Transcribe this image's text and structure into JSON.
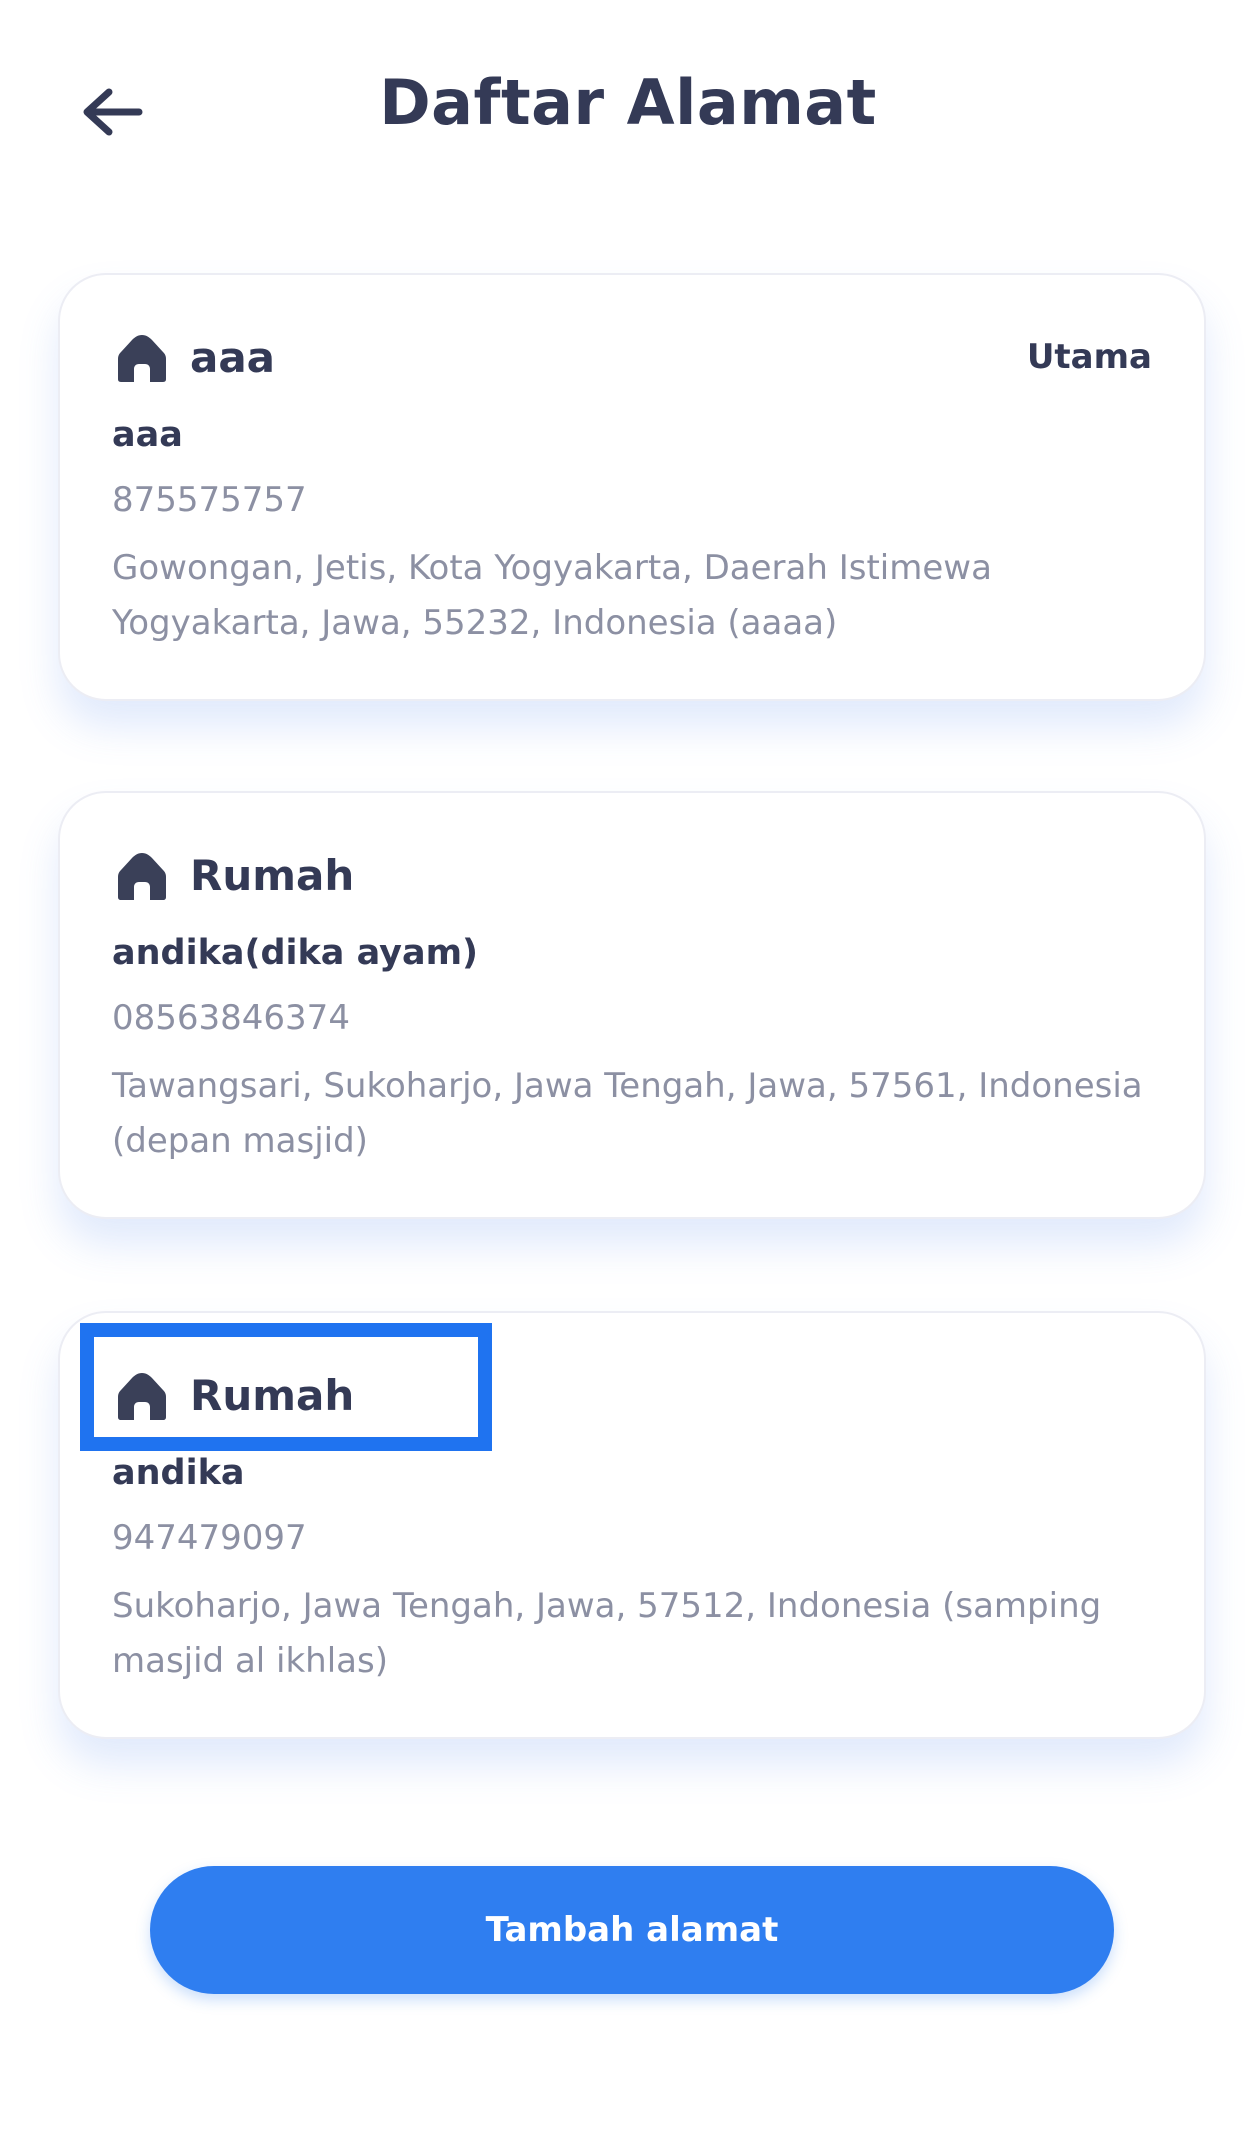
{
  "header": {
    "title": "Daftar Alamat",
    "back_icon": "arrow-left-icon"
  },
  "addresses": [
    {
      "label": "aaa",
      "badge": "Utama",
      "recipient": "aaa",
      "phone": "875575757",
      "address": "Gowongan, Jetis, Kota Yogyakarta, Daerah Istimewa Yogyakarta, Jawa, 55232, Indonesia (aaaa)",
      "icon": "home-icon"
    },
    {
      "label": "Rumah",
      "recipient": "andika(dika ayam)",
      "phone": "08563846374",
      "address": "Tawangsari, Sukoharjo, Jawa Tengah, Jawa, 57561, Indonesia (depan masjid)",
      "icon": "home-icon"
    },
    {
      "label": "Rumah",
      "recipient": "andika",
      "phone": "947479097",
      "address": "Sukoharjo, Jawa Tengah, Jawa, 57512, Indonesia (samping masjid al ikhlas)",
      "icon": "home-icon"
    }
  ],
  "footer": {
    "add_button_label": "Tambah alamat"
  },
  "colors": {
    "primary": "#2f7ef0",
    "text_dark": "#343a56",
    "text_muted": "#8c90a3",
    "highlight": "#1f73f0"
  }
}
